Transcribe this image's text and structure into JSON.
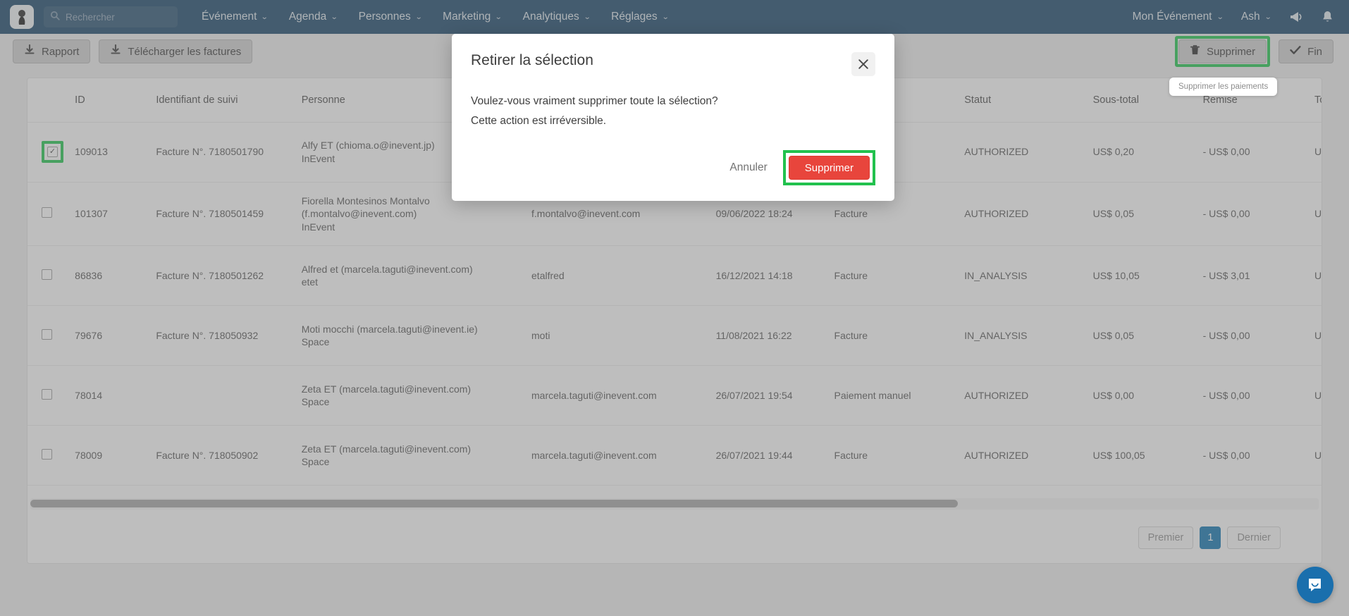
{
  "navbar": {
    "logo_icon": "company-logo",
    "search_placeholder": "Rechercher",
    "search_value": "",
    "menu": [
      {
        "label": "Événement"
      },
      {
        "label": "Agenda"
      },
      {
        "label": "Personnes"
      },
      {
        "label": "Marketing"
      },
      {
        "label": "Analytiques"
      },
      {
        "label": "Réglages"
      }
    ],
    "right": [
      {
        "label": "Mon Événement"
      },
      {
        "label": "Ash"
      }
    ],
    "megaphone_icon": "megaphone-icon",
    "bell_icon": "bell-icon",
    "caret": "⌄"
  },
  "toolbar": {
    "report_label": "Rapport",
    "download_invoices_label": "Télécharger les factures",
    "delete_label": "Supprimer",
    "finish_label": "Fin",
    "delete_tooltip": "Supprimer les paiements"
  },
  "table": {
    "headers": [
      "",
      "ID",
      "Identifiant de suivi",
      "Personne",
      "",
      "",
      "",
      "Statut",
      "Sous-total",
      "Remise",
      "To"
    ],
    "rows": [
      {
        "checked": true,
        "highlight": true,
        "id": "109013",
        "tracking": "Facture N°. 7180501790",
        "person": "Alfy ET (chioma.o@inevent.jp)",
        "person_sub": "InEvent",
        "email": "",
        "date": "",
        "type": "",
        "status": "AUTHORIZED",
        "subtotal": "US$ 0,20",
        "discount": "- US$ 0,00",
        "total": "US"
      },
      {
        "checked": false,
        "highlight": false,
        "id": "101307",
        "tracking": "Facture N°. 7180501459",
        "person": "Fiorella Montesinos Montalvo (f.montalvo@inevent.com)",
        "person_sub": "InEvent",
        "email": "f.montalvo@inevent.com",
        "date": "09/06/2022 18:24",
        "type": "Facture",
        "status": "AUTHORIZED",
        "subtotal": "US$ 0,05",
        "discount": "- US$ 0,00",
        "total": "US"
      },
      {
        "checked": false,
        "highlight": false,
        "id": "86836",
        "tracking": "Facture N°. 7180501262",
        "person": "Alfred et (marcela.taguti@inevent.com)",
        "person_sub": "etet",
        "email": "etalfred",
        "date": "16/12/2021 14:18",
        "type": "Facture",
        "status": "IN_ANALYSIS",
        "subtotal": "US$ 10,05",
        "discount": "- US$ 3,01",
        "total": "US"
      },
      {
        "checked": false,
        "highlight": false,
        "id": "79676",
        "tracking": "Facture N°. 718050932",
        "person": "Moti mocchi (marcela.taguti@inevent.ie)",
        "person_sub": "Space",
        "email": "moti",
        "date": "11/08/2021 16:22",
        "type": "Facture",
        "status": "IN_ANALYSIS",
        "subtotal": "US$ 0,05",
        "discount": "- US$ 0,00",
        "total": "US"
      },
      {
        "checked": false,
        "highlight": false,
        "id": "78014",
        "tracking": "",
        "person": "Zeta ET (marcela.taguti@inevent.com)",
        "person_sub": "Space",
        "email": "marcela.taguti@inevent.com",
        "date": "26/07/2021 19:54",
        "type": "Paiement manuel",
        "status": "AUTHORIZED",
        "subtotal": "US$ 0,00",
        "discount": "- US$ 0,00",
        "total": "US"
      },
      {
        "checked": false,
        "highlight": false,
        "id": "78009",
        "tracking": "Facture N°. 718050902",
        "person": "Zeta ET (marcela.taguti@inevent.com)",
        "person_sub": "Space",
        "email": "marcela.taguti@inevent.com",
        "date": "26/07/2021 19:44",
        "type": "Facture",
        "status": "AUTHORIZED",
        "subtotal": "US$ 100,05",
        "discount": "- US$ 0,00",
        "total": "US"
      }
    ]
  },
  "pagination": {
    "first_label": "Premier",
    "current_page": "1",
    "last_label": "Dernier"
  },
  "modal": {
    "title": "Retirer la sélection",
    "close_icon": "close-icon",
    "line1": "Voulez-vous vraiment supprimer toute la sélection?",
    "line2": "Cette action est irréversible.",
    "cancel_label": "Annuler",
    "confirm_label": "Supprimer"
  },
  "intercom": {
    "icon": "chat-bubble-icon"
  },
  "colors": {
    "navbar": "#1b4568",
    "highlight_green": "#22c14e",
    "danger_red": "#e8453c",
    "page_active_blue": "#1273ad",
    "intercom_blue": "#1a6fad"
  }
}
